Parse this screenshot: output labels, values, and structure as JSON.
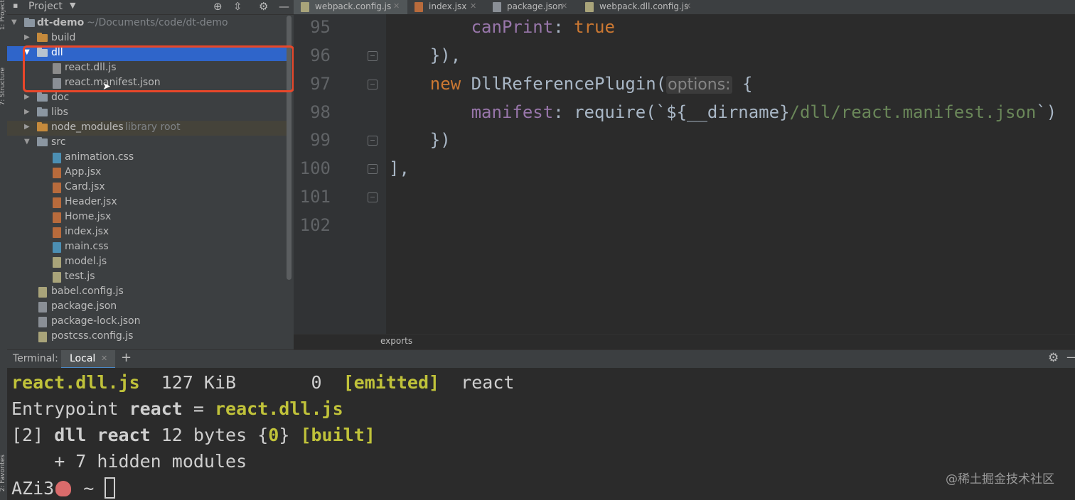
{
  "sidebar_strip": {
    "project_label": "1: Project",
    "structure_label": "7: Structure",
    "favorites_label": "2: Favorites"
  },
  "project_panel": {
    "title": "Project",
    "tree": [
      {
        "label": "dt-demo",
        "secondary": "~/Documents/code/dt-demo",
        "type": "folder",
        "expanded": true
      },
      {
        "label": "build",
        "type": "folder-orange",
        "expanded": false
      },
      {
        "label": "dll",
        "type": "folder",
        "expanded": true,
        "selected": true
      },
      {
        "label": "react.dll.js",
        "type": "file-dll"
      },
      {
        "label": "react.manifest.json",
        "type": "file-json"
      },
      {
        "label": "doc",
        "type": "folder",
        "expanded": false
      },
      {
        "label": "libs",
        "type": "folder",
        "expanded": false
      },
      {
        "label": "node_modules",
        "secondary": "library root",
        "type": "folder-orange",
        "expanded": false
      },
      {
        "label": "src",
        "type": "folder",
        "expanded": true
      },
      {
        "label": "animation.css",
        "type": "file-css"
      },
      {
        "label": "App.jsx",
        "type": "file-jsx"
      },
      {
        "label": "Card.jsx",
        "type": "file-jsx"
      },
      {
        "label": "Header.jsx",
        "type": "file-jsx"
      },
      {
        "label": "Home.jsx",
        "type": "file-jsx"
      },
      {
        "label": "index.jsx",
        "type": "file-jsx"
      },
      {
        "label": "main.css",
        "type": "file-css"
      },
      {
        "label": "model.js",
        "type": "file-js"
      },
      {
        "label": "test.js",
        "type": "file-js"
      },
      {
        "label": "babel.config.js",
        "type": "file-js"
      },
      {
        "label": "package.json",
        "type": "file-json"
      },
      {
        "label": "package-lock.json",
        "type": "file-json"
      },
      {
        "label": "postcss.config.js",
        "type": "file-js"
      }
    ]
  },
  "tabs": [
    {
      "label": "webpack.config.js",
      "active": true
    },
    {
      "label": "index.jsx",
      "active": false
    },
    {
      "label": "package.json",
      "active": false
    },
    {
      "label": "webpack.dll.config.js",
      "active": false
    }
  ],
  "editor": {
    "line_numbers": [
      "95",
      "96",
      "97",
      "98",
      "99",
      "100",
      "101",
      "102"
    ],
    "code": {
      "l95_prop": "canPrint",
      "l95_rest": ": ",
      "l95_val": "true",
      "l96": "}),",
      "l97_kw": "new",
      "l97_fn": " DllReferencePlugin(",
      "l97_hint": "options:",
      "l97_end": " {",
      "l98_prop": "manifest",
      "l98_mid": ": require(`${__dirname}",
      "l98_str": "/dll/react.manifest.json",
      "l98_end": "`)",
      "l99": "})",
      "l100": "],"
    },
    "breadcrumb": "exports"
  },
  "terminal": {
    "title": "Terminal:",
    "tab": "Local",
    "lines": {
      "l1_file": "react.dll.js",
      "l1_size": "  127 KiB       0  ",
      "l1_emitted": "[emitted]",
      "l1_chunk": "  react",
      "l2_prefix": "Entrypoint ",
      "l2_name": "react",
      "l2_eq": " = ",
      "l2_file": "react.dll.js",
      "l3_id": "[2] ",
      "l3_mod": "dll react",
      "l3_mid": " 12 bytes {",
      "l3_chunk": "0",
      "l3_close": "} ",
      "l3_built": "[built]",
      "l4": "    + 7 hidden modules",
      "prompt_user": "AZi3",
      "prompt_path": " ~ "
    }
  },
  "watermark": "@稀土掘金技术社区",
  "colors": {
    "accent_selection": "#2f65ca",
    "highlight_box": "#e8472a",
    "terminal_yellow": "#c0c23a",
    "keyword": "#cc7832",
    "property": "#9876aa",
    "string": "#6a8759"
  },
  "icons": [
    "settings-icon",
    "locate-icon",
    "collapse-icon",
    "minimize-icon",
    "add-tab-icon"
  ]
}
